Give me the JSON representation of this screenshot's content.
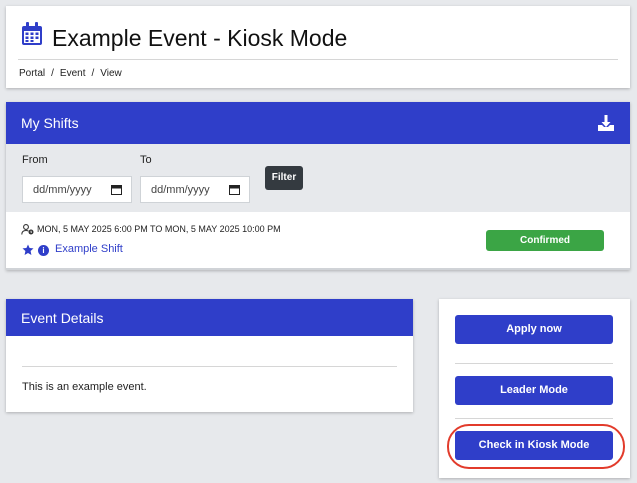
{
  "header": {
    "title": "Example Event - Kiosk Mode",
    "breadcrumbs": [
      "Portal",
      "Event",
      "View"
    ],
    "icon": "calendar-icon"
  },
  "shifts_panel": {
    "title": "My Shifts",
    "download_icon": "download-icon",
    "filter": {
      "from_label": "From",
      "to_label": "To",
      "from_placeholder": "dd/mm/yyyy",
      "to_placeholder": "dd/mm/yyyy",
      "button_label": "Filter"
    },
    "shift": {
      "datetime": "MON, 5 MAY 2025 6:00 PM TO MON, 5 MAY 2025 10:00 PM",
      "name": "Example Shift",
      "status": "Confirmed",
      "info_glyph": "i"
    }
  },
  "event_details": {
    "title": "Event Details",
    "description": "This is an example event."
  },
  "actions": {
    "apply_label": "Apply now",
    "leader_label": "Leader Mode",
    "kiosk_label": "Check in Kiosk Mode"
  },
  "colors": {
    "primary": "#2f3ec9",
    "success": "#3ba545",
    "dark": "#343a40",
    "highlight": "#e23b2b",
    "background": "#e7e9ec"
  }
}
